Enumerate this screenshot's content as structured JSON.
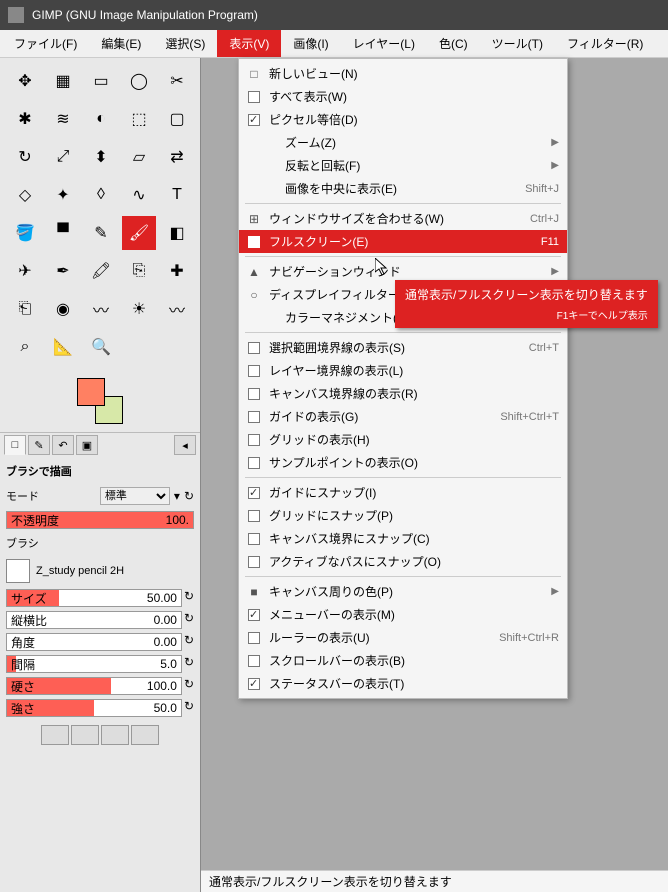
{
  "title": "GIMP (GNU Image Manipulation Program)",
  "menus": [
    "ファイル(F)",
    "編集(E)",
    "選択(S)",
    "表示(V)",
    "画像(I)",
    "レイヤー(L)",
    "色(C)",
    "ツール(T)",
    "フィルター(R)"
  ],
  "active_menu_index": 3,
  "dropdown": [
    {
      "type": "item",
      "label": "新しいビュー(N)",
      "icon": "□"
    },
    {
      "type": "item",
      "label": "すべて表示(W)",
      "icon": "chk",
      "checked": false
    },
    {
      "type": "item",
      "label": "ピクセル等倍(D)",
      "icon": "chk",
      "checked": true
    },
    {
      "type": "sub",
      "label": "ズーム(Z)",
      "indent": true
    },
    {
      "type": "sub",
      "label": "反転と回転(F)",
      "indent": true
    },
    {
      "type": "item",
      "label": "画像を中央に表示(E)",
      "shortcut": "Shift+J",
      "indent": true
    },
    {
      "type": "sep"
    },
    {
      "type": "item",
      "label": "ウィンドウサイズを合わせる(W)",
      "shortcut": "Ctrl+J",
      "icon": "⊞"
    },
    {
      "type": "item",
      "label": "フルスクリーン(E)",
      "shortcut": "F11",
      "icon": "chk",
      "checked": false,
      "hl": true
    },
    {
      "type": "sep"
    },
    {
      "type": "sub",
      "label": "ナビゲーションウィンド",
      "icon": "▲"
    },
    {
      "type": "sub",
      "label": "ディスプレイフィルター",
      "icon": "○"
    },
    {
      "type": "sub",
      "label": "カラーマネジメント(C)",
      "indent": true
    },
    {
      "type": "sep"
    },
    {
      "type": "item",
      "label": "選択範囲境界線の表示(S)",
      "shortcut": "Ctrl+T",
      "icon": "chk",
      "checked": false
    },
    {
      "type": "item",
      "label": "レイヤー境界線の表示(L)",
      "icon": "chk",
      "checked": false
    },
    {
      "type": "item",
      "label": "キャンバス境界線の表示(R)",
      "icon": "chk",
      "checked": false
    },
    {
      "type": "item",
      "label": "ガイドの表示(G)",
      "shortcut": "Shift+Ctrl+T",
      "icon": "chk",
      "checked": false
    },
    {
      "type": "item",
      "label": "グリッドの表示(H)",
      "icon": "chk",
      "checked": false
    },
    {
      "type": "item",
      "label": "サンプルポイントの表示(O)",
      "icon": "chk",
      "checked": false
    },
    {
      "type": "sep"
    },
    {
      "type": "item",
      "label": "ガイドにスナップ(I)",
      "icon": "chk",
      "checked": true
    },
    {
      "type": "item",
      "label": "グリッドにスナップ(P)",
      "icon": "chk",
      "checked": false
    },
    {
      "type": "item",
      "label": "キャンバス境界にスナップ(C)",
      "icon": "chk",
      "checked": false
    },
    {
      "type": "item",
      "label": "アクティブなパスにスナップ(O)",
      "icon": "chk",
      "checked": false
    },
    {
      "type": "sep"
    },
    {
      "type": "sub",
      "label": "キャンバス周りの色(P)",
      "icon": "■"
    },
    {
      "type": "item",
      "label": "メニューバーの表示(M)",
      "icon": "chk",
      "checked": true
    },
    {
      "type": "item",
      "label": "ルーラーの表示(U)",
      "shortcut": "Shift+Ctrl+R",
      "icon": "chk",
      "checked": false
    },
    {
      "type": "item",
      "label": "スクロールバーの表示(B)",
      "icon": "chk",
      "checked": false
    },
    {
      "type": "item",
      "label": "ステータスバーの表示(T)",
      "icon": "chk",
      "checked": true
    }
  ],
  "tooltip": {
    "line1": "通常表示/フルスクリーン表示を切り替えます",
    "line2": "F1キーでヘルプ表示"
  },
  "statusbar": "通常表示/フルスクリーン表示を切り替えます",
  "options": {
    "title": "ブラシで描画",
    "mode_label": "モード",
    "mode_value": "標準",
    "opacity_label": "不透明度",
    "opacity_value": "100.",
    "brush_label": "ブラシ",
    "brush_name": "Z_study pencil 2H",
    "size_label": "サイズ",
    "size_value": "50.00",
    "aspect_label": "縦横比",
    "aspect_value": "0.00",
    "angle_label": "角度",
    "angle_value": "0.00",
    "spacing_label": "間隔",
    "spacing_value": "5.0",
    "hardness_label": "硬さ",
    "hardness_value": "100.0",
    "force_label": "強さ",
    "force_value": "50.0"
  },
  "colors": {
    "fg": "#ff8062",
    "bg": "#d7e8a8",
    "accent": "#d22"
  }
}
